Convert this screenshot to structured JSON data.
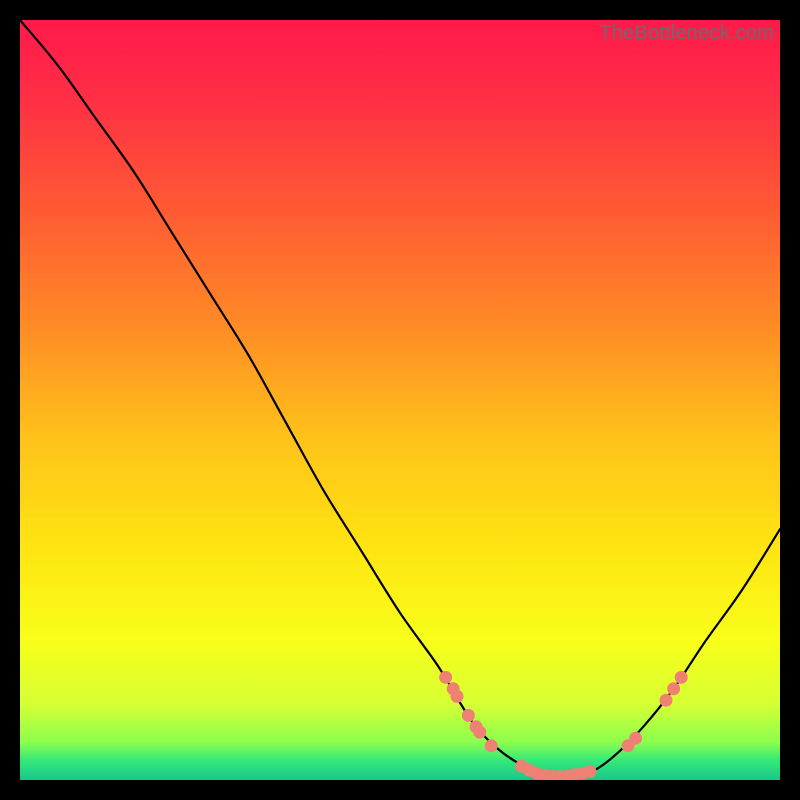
{
  "watermark": "TheBottleneck.com",
  "colors": {
    "background": "#000000",
    "gradient_stops": [
      {
        "offset": 0.0,
        "color": "#ff1a4b"
      },
      {
        "offset": 0.1,
        "color": "#ff2e45"
      },
      {
        "offset": 0.25,
        "color": "#ff5a33"
      },
      {
        "offset": 0.4,
        "color": "#ff8a26"
      },
      {
        "offset": 0.55,
        "color": "#ffc21a"
      },
      {
        "offset": 0.7,
        "color": "#ffe612"
      },
      {
        "offset": 0.82,
        "color": "#f7ff1a"
      },
      {
        "offset": 0.9,
        "color": "#d6ff33"
      },
      {
        "offset": 0.95,
        "color": "#8cff4d"
      },
      {
        "offset": 0.975,
        "color": "#33e87a"
      },
      {
        "offset": 1.0,
        "color": "#18c78a"
      }
    ],
    "curve": "#000000",
    "marker_fill": "#ef8074",
    "marker_stroke": "#d25a5a"
  },
  "chart_data": {
    "type": "line",
    "title": "",
    "xlabel": "",
    "ylabel": "",
    "xlim": [
      0,
      100
    ],
    "ylim": [
      0,
      100
    ],
    "series": [
      {
        "name": "bottleneck-curve",
        "x": [
          0,
          5,
          10,
          15,
          20,
          25,
          30,
          35,
          40,
          45,
          50,
          55,
          58,
          60,
          63,
          66,
          69,
          72,
          75,
          78,
          82,
          86,
          90,
          95,
          100
        ],
        "y": [
          100,
          94,
          87,
          80,
          72,
          64,
          56,
          47,
          38,
          30,
          22,
          15,
          10,
          7,
          4,
          2,
          1,
          0.5,
          1,
          3,
          7,
          12,
          18,
          25,
          33
        ]
      }
    ],
    "markers": [
      {
        "x": 56,
        "y": 13.5
      },
      {
        "x": 57,
        "y": 12
      },
      {
        "x": 57.5,
        "y": 11
      },
      {
        "x": 59,
        "y": 8.5
      },
      {
        "x": 60,
        "y": 7
      },
      {
        "x": 60.5,
        "y": 6.3
      },
      {
        "x": 62,
        "y": 4.5
      },
      {
        "x": 66,
        "y": 1.8
      },
      {
        "x": 67,
        "y": 1.3
      },
      {
        "x": 68,
        "y": 0.9
      },
      {
        "x": 69,
        "y": 0.6
      },
      {
        "x": 70,
        "y": 0.5
      },
      {
        "x": 71,
        "y": 0.45
      },
      {
        "x": 72,
        "y": 0.5
      },
      {
        "x": 73,
        "y": 0.7
      },
      {
        "x": 74,
        "y": 0.9
      },
      {
        "x": 75,
        "y": 1.1
      },
      {
        "x": 80,
        "y": 4.5
      },
      {
        "x": 81,
        "y": 5.5
      },
      {
        "x": 85,
        "y": 10.5
      },
      {
        "x": 86,
        "y": 12
      },
      {
        "x": 87,
        "y": 13.5
      }
    ]
  }
}
